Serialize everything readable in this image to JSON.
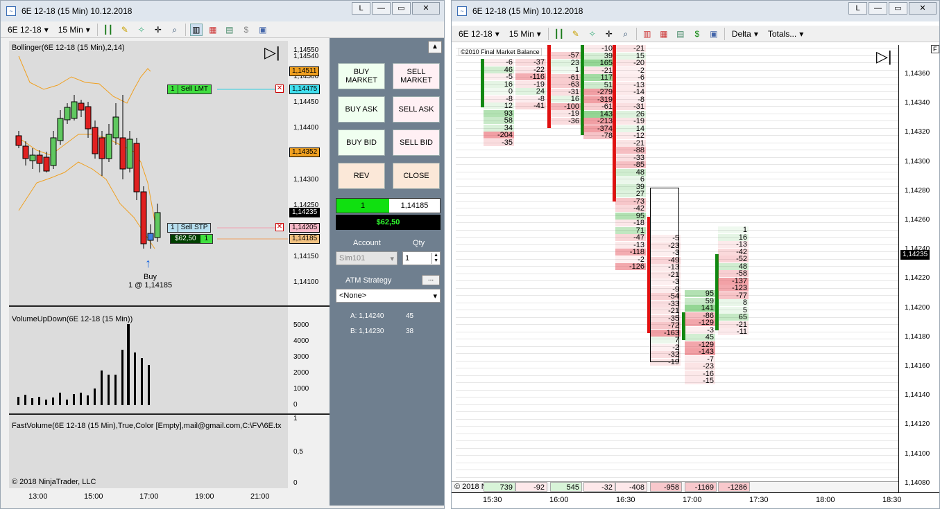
{
  "left_window": {
    "title": "6E 12-18 (15 Min)  10.12.2018",
    "btn_l": "L",
    "btn_min": "—",
    "btn_max": "▭",
    "btn_close": "✕",
    "toolbar": {
      "instrument": "6E 12-18",
      "interval": "15 Min"
    },
    "bollinger_label": "Bollinger(6E 12-18 (15 Min),2,14)",
    "volume_label": "VolumeUpDown(6E 12-18 (15 Min))",
    "fastvolume_label": "FastVolume(6E 12-18 (15 Min),True,Color [Empty],mail@gmail.com,C:\\FV\\6E.tx",
    "copyright": "© 2018 NinjaTrader, LLC",
    "price_ticks": [
      "1,14550",
      "1,14540",
      "1,14500",
      "1,14450",
      "1,14400",
      "1,14350",
      "1,14300",
      "1,14250",
      "1,14200",
      "1,14150",
      "1,14100"
    ],
    "price_tags": {
      "t1": "1,14511",
      "t2": "1,14475",
      "t3": "1,14352",
      "t4": "1,14235",
      "t5": "1,14205",
      "t6": "1,14185"
    },
    "sell_lmt": {
      "qty": "1",
      "label": "Sell LMT"
    },
    "sell_stp": {
      "qty": "1",
      "label": "Sell STP"
    },
    "position": {
      "pnl": "$62,50",
      "qty": "1"
    },
    "buy_marker": {
      "label": "Buy",
      "detail": "1 @ 1,14185"
    },
    "volume_ticks": [
      "5000",
      "4000",
      "3000",
      "2000",
      "1000",
      "0"
    ],
    "fv_ticks": [
      "1",
      "0,5",
      "0"
    ],
    "time_labels": [
      "13:00",
      "15:00",
      "17:00",
      "19:00",
      "21:00"
    ],
    "play_icon": "▷|"
  },
  "order_panel": {
    "buy_market": "BUY MARKET",
    "sell_market": "SELL MARKET",
    "buy_ask": "BUY ASK",
    "sell_ask": "SELL ASK",
    "buy_bid": "BUY BID",
    "sell_bid": "SELL BID",
    "rev": "REV",
    "close": "CLOSE",
    "pos_qty": "1",
    "pos_price": "1,14185",
    "pnl": "$62,50",
    "account_label": "Account",
    "qty_label": "Qty",
    "account_value": "Sim101",
    "qty_value": "1",
    "atm_label": "ATM Strategy",
    "atm_btn": "...",
    "atm_value": "<None>",
    "ask_label": "A: 1,14240",
    "ask_size": "45",
    "bid_label": "B: 1,14230",
    "bid_size": "38"
  },
  "right_window": {
    "title": "6E 12-18 (15 Min)  10.12.2018",
    "btn_l": "L",
    "btn_min": "—",
    "btn_max": "▭",
    "btn_close": "✕",
    "toolbar": {
      "instrument": "6E 12-18",
      "interval": "15 Min",
      "delta": "Delta",
      "totals": "Totals..."
    },
    "copyright_top": "©2010 Final Market Balance",
    "copyright_bottom": "© 2018 NinjaTrader, LLC",
    "f_marker": "F",
    "play_icon": "▷|",
    "price_ticks": [
      "1,14360",
      "1,14340",
      "1,14320",
      "1,14300",
      "1,14280",
      "1,14260",
      "1,14240",
      "1,14220",
      "1,14200",
      "1,14180",
      "1,14160",
      "1,14140",
      "1,14120",
      "1,14100",
      "1,14080"
    ],
    "current_price": "1,14235",
    "time_labels": [
      "15:30",
      "16:00",
      "16:30",
      "17:00",
      "17:30",
      "18:00",
      "18:30"
    ],
    "totals": [
      "739",
      "-92",
      "545",
      "-32",
      "-408",
      "-958",
      "-1169",
      "-1286"
    ]
  },
  "footprint": {
    "col1": [
      "-6",
      "46",
      "-5",
      "16",
      "0",
      "-8",
      "12",
      "93",
      "58",
      "34",
      "-204",
      "-35"
    ],
    "col2": [
      "-37",
      "-22",
      "-116",
      "-19",
      "24",
      "-8",
      "-41"
    ],
    "col3": [
      "-57",
      "23",
      "1",
      "-61",
      "-63",
      "-31",
      "16",
      "-100",
      "-19",
      "-36"
    ],
    "col4": [
      "-10",
      "39",
      "165",
      "-21",
      "117",
      "51",
      "-279",
      "-319",
      "-61",
      "143",
      "-213",
      "-374",
      "-78"
    ],
    "col5": [
      "-21",
      "15",
      "-20",
      "-2",
      "-6",
      "-13",
      "-14",
      "-8",
      "-31",
      "26",
      "-19",
      "14",
      "-12",
      "-21",
      "-88",
      "-33",
      "-85",
      "48",
      "6",
      "39",
      "27",
      "-73",
      "-42",
      "95",
      "-18",
      "71",
      "-47",
      "-13",
      "-118",
      "-2",
      "-126"
    ],
    "col6": [
      "-5",
      "-23",
      "-3",
      "-49",
      "-13",
      "-21",
      "-3",
      "-9",
      "-54",
      "-33",
      "-21",
      "-35",
      "-72",
      "-163",
      "7",
      "-2",
      "-32",
      "-19"
    ],
    "col7": [
      "95",
      "59",
      "141",
      "-86",
      "-129",
      "-3",
      "45",
      "-129",
      "-143",
      "-7",
      "-23",
      "-16",
      "-15"
    ],
    "col8": [
      "1",
      "16",
      "-13",
      "-42",
      "-52",
      "48",
      "-58",
      "-137",
      "-123",
      "-77",
      "8",
      "5",
      "65",
      "-21",
      "-11"
    ]
  }
}
